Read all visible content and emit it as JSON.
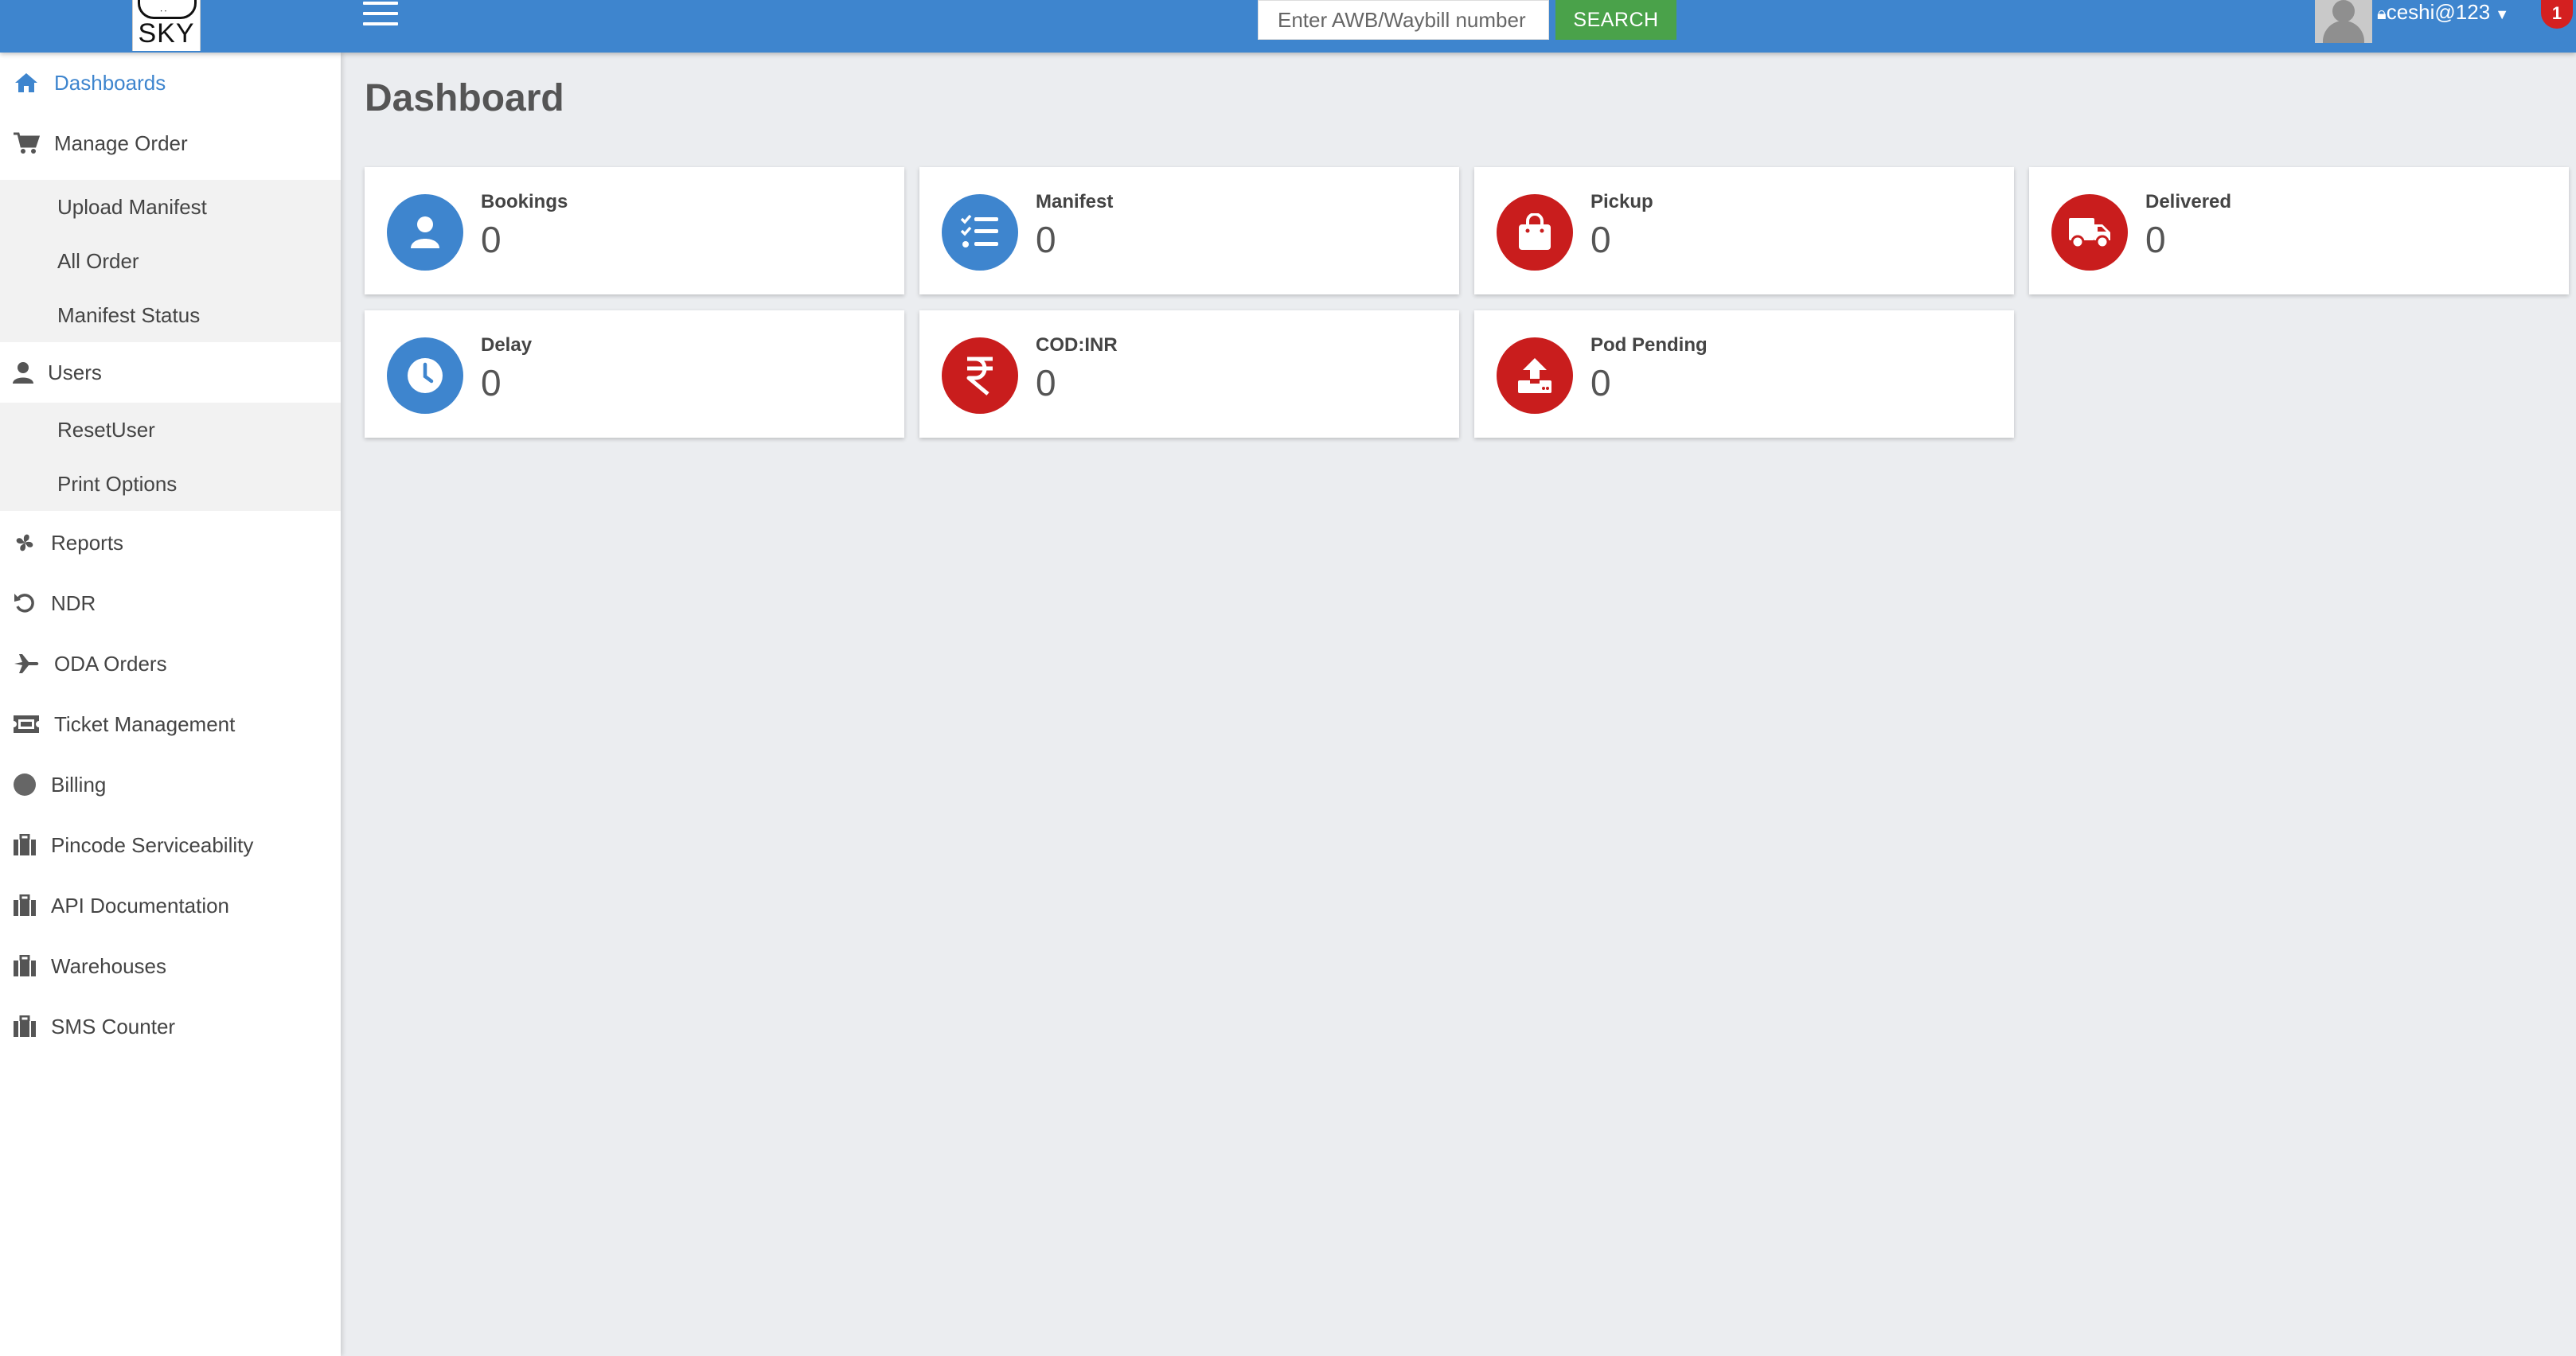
{
  "topbar": {
    "logo_text": "SKY",
    "search": {
      "placeholder": "Enter AWB/Waybill number",
      "button_label": "SEARCH"
    },
    "username": "ceshi@123",
    "notification_count": "1"
  },
  "sidebar": {
    "items": [
      {
        "label": "Dashboards",
        "icon": "home-icon"
      },
      {
        "label": "Manage Order",
        "icon": "cart-icon"
      },
      {
        "label": "Users",
        "icon": "user-icon"
      },
      {
        "label": "Reports",
        "icon": "fan-icon"
      },
      {
        "label": "NDR",
        "icon": "undo-icon"
      },
      {
        "label": "ODA Orders",
        "icon": "plane-icon"
      },
      {
        "label": "Ticket Management",
        "icon": "ticket-icon"
      },
      {
        "label": "Billing",
        "icon": "circle-icon"
      },
      {
        "label": "Pincode Serviceability",
        "icon": "briefcase-icon"
      },
      {
        "label": "API Documentation",
        "icon": "briefcase-icon"
      },
      {
        "label": "Warehouses",
        "icon": "briefcase-icon"
      },
      {
        "label": "SMS Counter",
        "icon": "briefcase-icon"
      }
    ],
    "manage_order_sub": [
      "Upload Manifest",
      "All Order",
      "Manifest Status"
    ],
    "users_sub": [
      "ResetUser",
      "Print Options"
    ]
  },
  "main": {
    "title": "Dashboard",
    "cards": [
      {
        "label": "Bookings",
        "value": "0",
        "icon": "user-icon",
        "color": "#3e85ce"
      },
      {
        "label": "Manifest",
        "value": "0",
        "icon": "list-check-icon",
        "color": "#3e85ce"
      },
      {
        "label": "Pickup",
        "value": "0",
        "icon": "bag-icon",
        "color": "#c91d1d"
      },
      {
        "label": "Delivered",
        "value": "0",
        "icon": "truck-icon",
        "color": "#c91d1d"
      },
      {
        "label": "Delay",
        "value": "0",
        "icon": "clock-icon",
        "color": "#3e85ce"
      },
      {
        "label": "COD:INR",
        "value": "0",
        "icon": "rupee-icon",
        "color": "#c91d1d"
      },
      {
        "label": "Pod Pending",
        "value": "0",
        "icon": "upload-icon",
        "color": "#c91d1d"
      }
    ]
  }
}
